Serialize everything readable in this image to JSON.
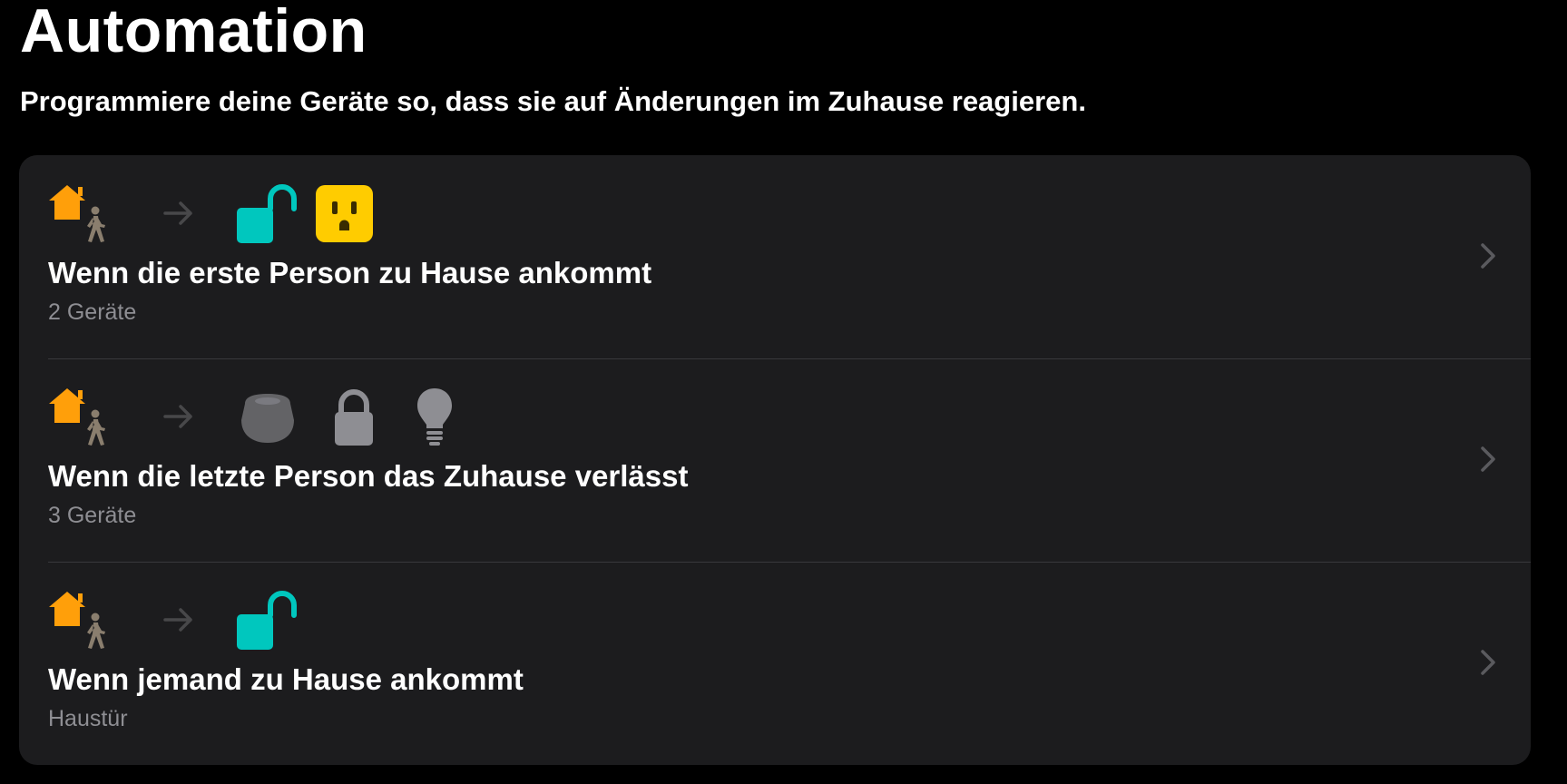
{
  "header": {
    "title": "Automation",
    "subtitle": "Programmiere deine Geräte so, dass sie auf Änderungen im Zuhause reagieren."
  },
  "colors": {
    "background": "#000000",
    "card": "#1c1c1e",
    "separator": "#38383c",
    "home_orange": "#ff9f0a",
    "person": "#8a7e6e",
    "lock_teal": "#00c7be",
    "outlet_yellow": "#ffcc00",
    "secondary_text": "#8e8e93",
    "device_gray": "#8e8e93",
    "speaker_gray": "#636366",
    "chevron": "#5a5a5e",
    "arrow": "#48484a"
  },
  "automations": [
    {
      "title": "Wenn die erste Person zu Hause ankommt",
      "subtitle": "2 Geräte",
      "trigger_icon": "home-person-icon",
      "action_icons": [
        "unlocked-lock-icon",
        "power-outlet-icon"
      ]
    },
    {
      "title": "Wenn die letzte Person das Zuhause verlässt",
      "subtitle": "3 Geräte",
      "trigger_icon": "home-person-icon",
      "action_icons": [
        "homepod-mini-icon",
        "locked-lock-icon",
        "light-bulb-icon"
      ]
    },
    {
      "title": "Wenn jemand zu Hause ankommt",
      "subtitle": "Haustür",
      "trigger_icon": "home-person-icon",
      "action_icons": [
        "unlocked-lock-icon"
      ]
    }
  ]
}
